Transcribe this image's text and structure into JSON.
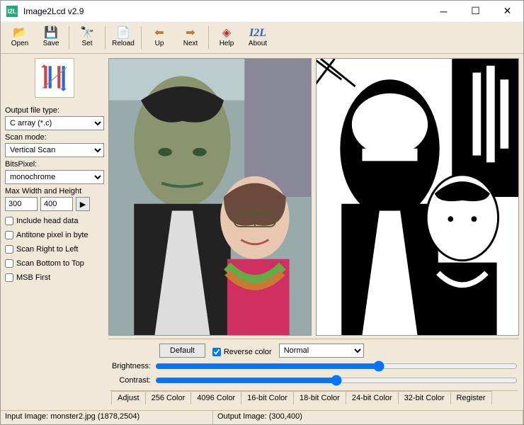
{
  "window": {
    "title": "Image2Lcd v2.9"
  },
  "toolbar": {
    "open": "Open",
    "save": "Save",
    "set": "Set",
    "reload": "Reload",
    "up": "Up",
    "next": "Next",
    "help": "Help",
    "about": "About"
  },
  "sidebar": {
    "output_label": "Output file type:",
    "output_value": "C array (*.c)",
    "scan_label": "Scan mode:",
    "scan_value": "Vertical Scan",
    "bits_label": "BitsPixel:",
    "bits_value": "monochrome",
    "wh_label": "Max Width and Height",
    "width": "300",
    "height": "400",
    "chk_head": "Include head data",
    "chk_antitone": "Antitone pixel in byte",
    "chk_scan_rl": "Scan Right to Left",
    "chk_scan_bt": "Scan Bottom to Top",
    "chk_msb": "MSB First"
  },
  "controls": {
    "default": "Default",
    "reverse": "Reverse color",
    "mode": "Normal",
    "brightness": "Brightness:",
    "contrast": "Contrast:"
  },
  "tabs": [
    "Adjust",
    "256 Color",
    "4096 Color",
    "16-bit Color",
    "18-bit Color",
    "24-bit Color",
    "32-bit Color",
    "Register"
  ],
  "status": {
    "input": "Input Image: monster2.jpg (1878,2504)",
    "output": "Output Image: (300,400)"
  }
}
